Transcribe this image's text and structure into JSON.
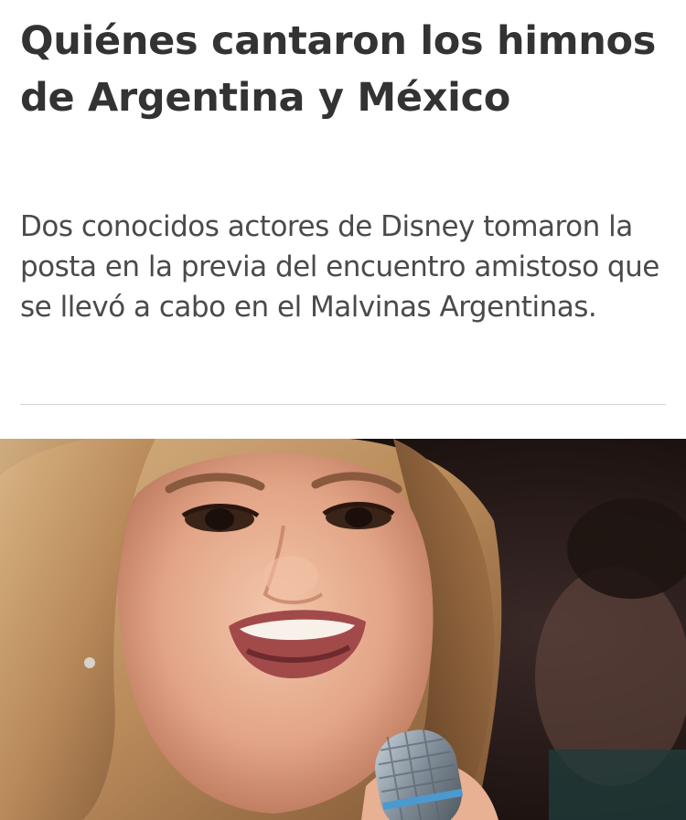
{
  "article": {
    "headline": "Quiénes cantaron los himnos de Argentina y México",
    "summary": "Dos conocidos actores de Disney tomaron la posta en la previa del encuentro amistoso que se llevó a cabo en el Malvinas Argentinas."
  }
}
